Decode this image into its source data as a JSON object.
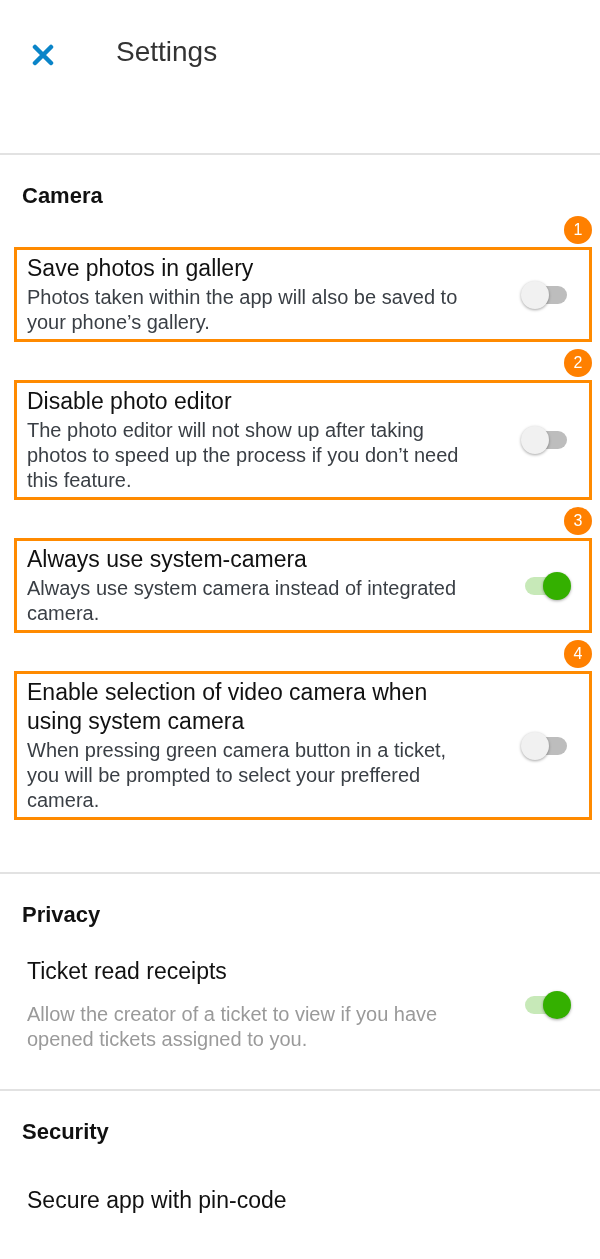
{
  "header": {
    "title": "Settings"
  },
  "sections": [
    {
      "title": "Camera",
      "items": [
        {
          "kind": "toggle",
          "title": "Save photos in gallery",
          "description": "Photos taken within the app will also be saved to your phone’s gallery.",
          "on": false,
          "highlighted": true,
          "marker": "1",
          "description_greyed": false
        },
        {
          "kind": "toggle",
          "title": "Disable photo editor",
          "description": "The photo editor will not show up after taking photos to speed up the process if you don’t need this feature.",
          "on": false,
          "highlighted": true,
          "marker": "2",
          "description_greyed": false
        },
        {
          "kind": "toggle",
          "title": "Always use system-camera",
          "description": "Always use system camera instead of integrated camera.",
          "on": true,
          "highlighted": true,
          "marker": "3",
          "description_greyed": false
        },
        {
          "kind": "toggle",
          "title": "Enable selection of video camera when using system camera",
          "description": "When pressing green camera button in a ticket, you will be prompted to select your preffered camera.",
          "on": false,
          "highlighted": true,
          "marker": "4",
          "description_greyed": false
        }
      ]
    },
    {
      "title": "Privacy",
      "items": [
        {
          "kind": "toggle",
          "title": "Ticket read receipts",
          "description": "Allow the creator of a ticket to view if you have opened tickets assigned to you.",
          "on": true,
          "highlighted": false,
          "description_greyed": true
        }
      ]
    },
    {
      "title": "Security",
      "items": [
        {
          "kind": "plain",
          "title": "Secure app with pin-code",
          "highlighted": false
        }
      ]
    }
  ]
}
